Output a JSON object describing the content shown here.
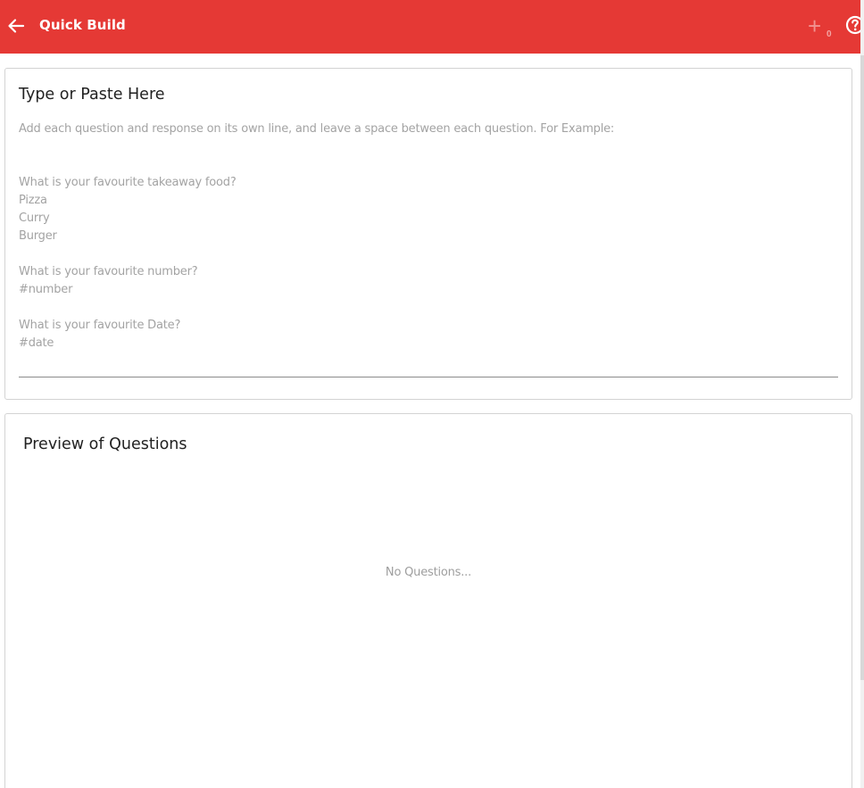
{
  "appbar": {
    "title": "Quick Build",
    "back_icon": "arrow-left-icon",
    "add_icon": "plus-icon",
    "add_count": "0",
    "help_icon": "help-circle-icon",
    "background_color": "#e53935"
  },
  "input_card": {
    "title": "Type or Paste Here",
    "instructions": "Add each question and response on its own line, and leave a space between each question. For Example:",
    "example_lines": [
      "",
      "What is your favourite takeaway food?",
      "Pizza",
      "Curry",
      "Burger",
      "",
      "What is your favourite number?",
      "#number",
      "",
      "What is your favourite Date?",
      "#date"
    ]
  },
  "preview_card": {
    "title": "Preview of Questions",
    "empty_message": "No Questions..."
  }
}
